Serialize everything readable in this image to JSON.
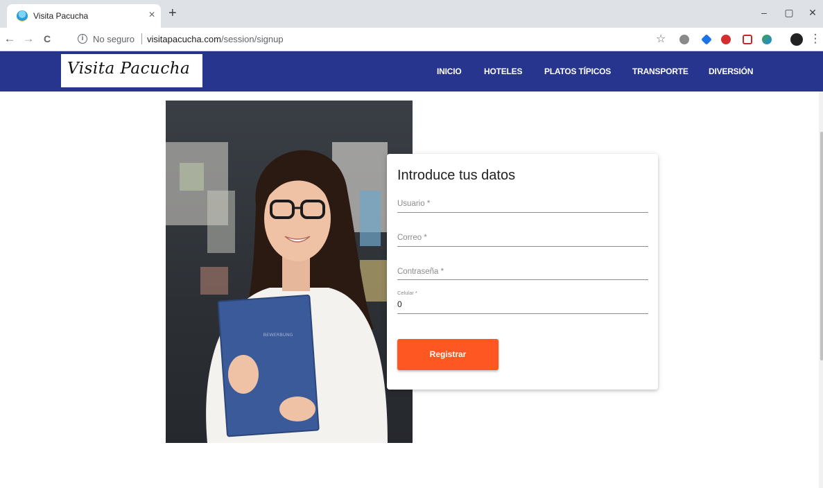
{
  "browser": {
    "tab_title": "Visita Pacucha",
    "tab_close": "×",
    "new_tab": "+",
    "security_label": "No seguro",
    "url_domain": "visitapacucha.com",
    "url_path": "/session/signup",
    "window_controls": {
      "minimize": "–",
      "restore": "▢",
      "close": "✕"
    },
    "nav": {
      "back": "←",
      "forward": "→",
      "reload": "C"
    },
    "icons": {
      "info": "i",
      "star": "☆",
      "menu": "⋮"
    }
  },
  "site": {
    "logo": "Visita Pacucha",
    "menu": [
      {
        "label": "INICIO"
      },
      {
        "label": "HOTELES"
      },
      {
        "label": "PLATOS TÍPICOS"
      },
      {
        "label": "TRANSPORTE"
      },
      {
        "label": "DIVERSIÓN"
      }
    ]
  },
  "form": {
    "title": "Introduce tus datos",
    "fields": {
      "usuario": {
        "label": "Usuario *"
      },
      "correo": {
        "label": "Correo *"
      },
      "contrasena": {
        "label": "Contraseña *"
      },
      "celular": {
        "label": "Celular *",
        "value": "0"
      }
    },
    "submit_label": "Registrar"
  },
  "photo_text": "BEWERBUNG",
  "colors": {
    "header_bg": "#27358f",
    "button_bg": "#ff5722",
    "folder_blue": "#3b5a9a"
  }
}
